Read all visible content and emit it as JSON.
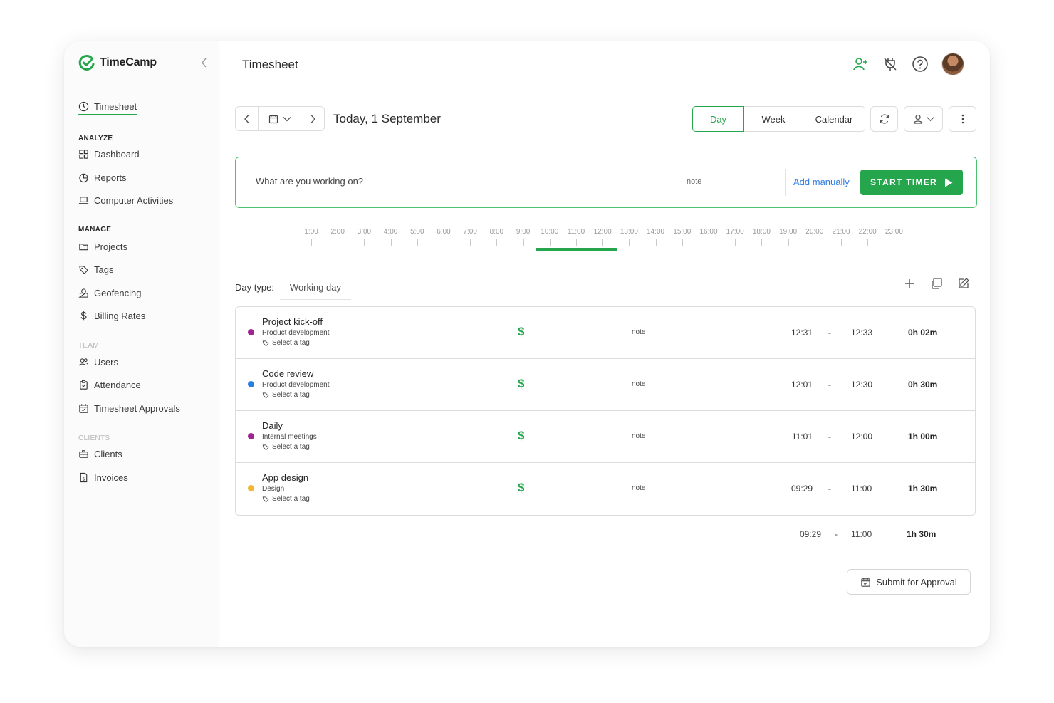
{
  "brand": {
    "name": "TimeCamp",
    "accent": "#25a64c"
  },
  "sidebar": {
    "timesheet": "Timesheet",
    "sections": [
      {
        "title": "ANALYZE",
        "items": [
          "Dashboard",
          "Reports",
          "Computer Activities"
        ]
      },
      {
        "title": "MANAGE",
        "items": [
          "Projects",
          "Tags",
          "Geofencing",
          "Billing Rates"
        ]
      },
      {
        "title": "TEAM",
        "items": [
          "Users",
          "Attendance",
          "Timesheet Approvals"
        ]
      },
      {
        "title": "CLIENTS",
        "items": [
          "Clients",
          "Invoices"
        ]
      }
    ]
  },
  "header": {
    "title": "Timesheet"
  },
  "date_nav": {
    "label": "Today, 1 September"
  },
  "views": {
    "day": "Day",
    "week": "Week",
    "calendar": "Calendar"
  },
  "timer": {
    "placeholder": "What are you working on?",
    "note": "note",
    "add_manually": "Add manually",
    "start": "START TIMER"
  },
  "timeline": {
    "labels": [
      "1:00",
      "2:00",
      "3:00",
      "4:00",
      "5:00",
      "6:00",
      "7:00",
      "8:00",
      "9:00",
      "10:00",
      "11:00",
      "12:00",
      "13:00",
      "14:00",
      "15:00",
      "16:00",
      "17:00",
      "18:00",
      "19:00",
      "20:00",
      "21:00",
      "22:00",
      "23:00"
    ],
    "tracked_start": 9.48,
    "tracked_end": 12.55
  },
  "day_type": {
    "label": "Day type:",
    "value": "Working day"
  },
  "entries": [
    {
      "title": "Project kick-off",
      "project": "Product development",
      "tag": "Select a tag",
      "billable": "$",
      "note": "note",
      "start": "12:31",
      "dash": "-",
      "end": "12:33",
      "duration": "0h 02m",
      "color": "#a0238e"
    },
    {
      "title": "Code review",
      "project": "Product development",
      "tag": "Select a tag",
      "billable": "$",
      "note": "note",
      "start": "12:01",
      "dash": "-",
      "end": "12:30",
      "duration": "0h 30m",
      "color": "#2a7de1"
    },
    {
      "title": "Daily",
      "project": "Internal meetings",
      "tag": "Select a tag",
      "billable": "$",
      "note": "note",
      "start": "11:01",
      "dash": "-",
      "end": "12:00",
      "duration": "1h 00m",
      "color": "#a0238e"
    },
    {
      "title": "App design",
      "project": "Design",
      "tag": "Select a tag",
      "billable": "$",
      "note": "note",
      "start": "09:29",
      "dash": "-",
      "end": "11:00",
      "duration": "1h 30m",
      "color": "#f2b632"
    }
  ],
  "summary": {
    "start": "09:29",
    "dash": "-",
    "end": "11:00",
    "duration": "1h 30m"
  },
  "submit": {
    "label": "Submit for Approval"
  }
}
